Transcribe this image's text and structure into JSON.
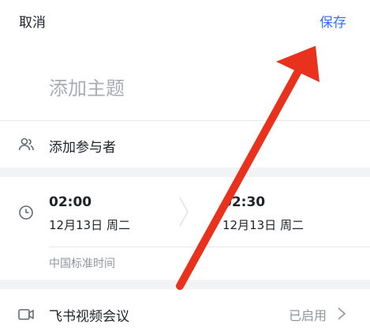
{
  "header": {
    "cancel_label": "取消",
    "save_label": "保存"
  },
  "title": {
    "placeholder": "添加主题"
  },
  "participants": {
    "label": "添加参与者",
    "icon": "people-icon"
  },
  "time": {
    "icon": "clock-icon",
    "start_time": "02:00",
    "start_date": "12月13日  周二",
    "end_time": "02:30",
    "end_date": "12月13日  周二",
    "timezone": "中国标准时间"
  },
  "video_meeting": {
    "label": "飞书视频会议",
    "status": "已启用",
    "icon": "video-camera-icon"
  },
  "colors": {
    "accent": "#3370ff",
    "arrow": "#e8321e",
    "muted": "#8f959e",
    "placeholder": "#a9adb3",
    "gap": "#f2f3f5"
  }
}
